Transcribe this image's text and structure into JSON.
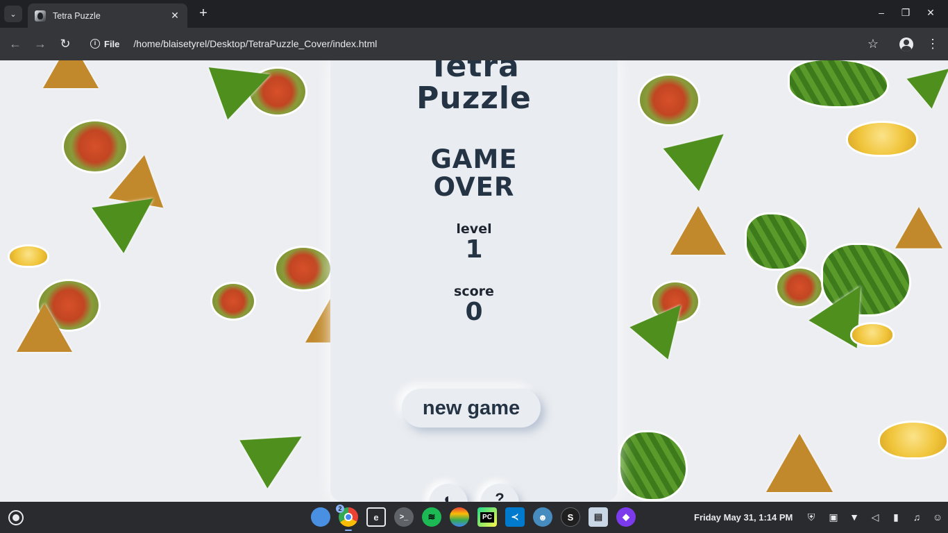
{
  "browser": {
    "tab_title": "Tetra Puzzle",
    "tab_close": "✕",
    "new_tab": "+",
    "site_label": "File",
    "url": "/home/blaisetyrel/Desktop/TetraPuzzle_Cover/index.html",
    "back": "←",
    "forward": "→",
    "reload": "↻",
    "bookmark": "☆",
    "menu": "⋮",
    "minimize": "–",
    "restore": "❐",
    "close": "✕"
  },
  "game": {
    "title_line1": "Tetra",
    "title_line2": "Puzzle",
    "status_line1": "GAME",
    "status_line2": "OVER",
    "level_label": "level",
    "level_value": "1",
    "score_label": "score",
    "score_value": "0",
    "new_game_label": "new game",
    "theme_toggle_glyph": "◐",
    "help_glyph": "?"
  },
  "shelf": {
    "chrome_badge": "2",
    "clock": "Friday May 31, 1:14 PM",
    "apps": [
      {
        "name": "files-app",
        "color": "#4a90e2",
        "glyph": ""
      },
      {
        "name": "chrome-app",
        "color": "#ea4335",
        "glyph": ""
      },
      {
        "name": "text-editor-app",
        "color": "#3c4043",
        "glyph": "e"
      },
      {
        "name": "terminal-app",
        "color": "#5f6368",
        "glyph": ">_"
      },
      {
        "name": "spotify-app",
        "color": "#1db954",
        "glyph": "≋"
      },
      {
        "name": "layers-app",
        "color": "#f29900",
        "glyph": "◆"
      },
      {
        "name": "pycharm-app",
        "color": "#21d789",
        "glyph": "PC"
      },
      {
        "name": "vscode-app",
        "color": "#007acc",
        "glyph": "≺"
      },
      {
        "name": "godot-app",
        "color": "#478cbf",
        "glyph": "☻"
      },
      {
        "name": "s-app",
        "color": "#1f1f1f",
        "glyph": "S"
      },
      {
        "name": "video-app",
        "color": "#8ab4f8",
        "glyph": "▤"
      },
      {
        "name": "obsidian-app",
        "color": "#7c3aed",
        "glyph": "◆"
      }
    ]
  }
}
